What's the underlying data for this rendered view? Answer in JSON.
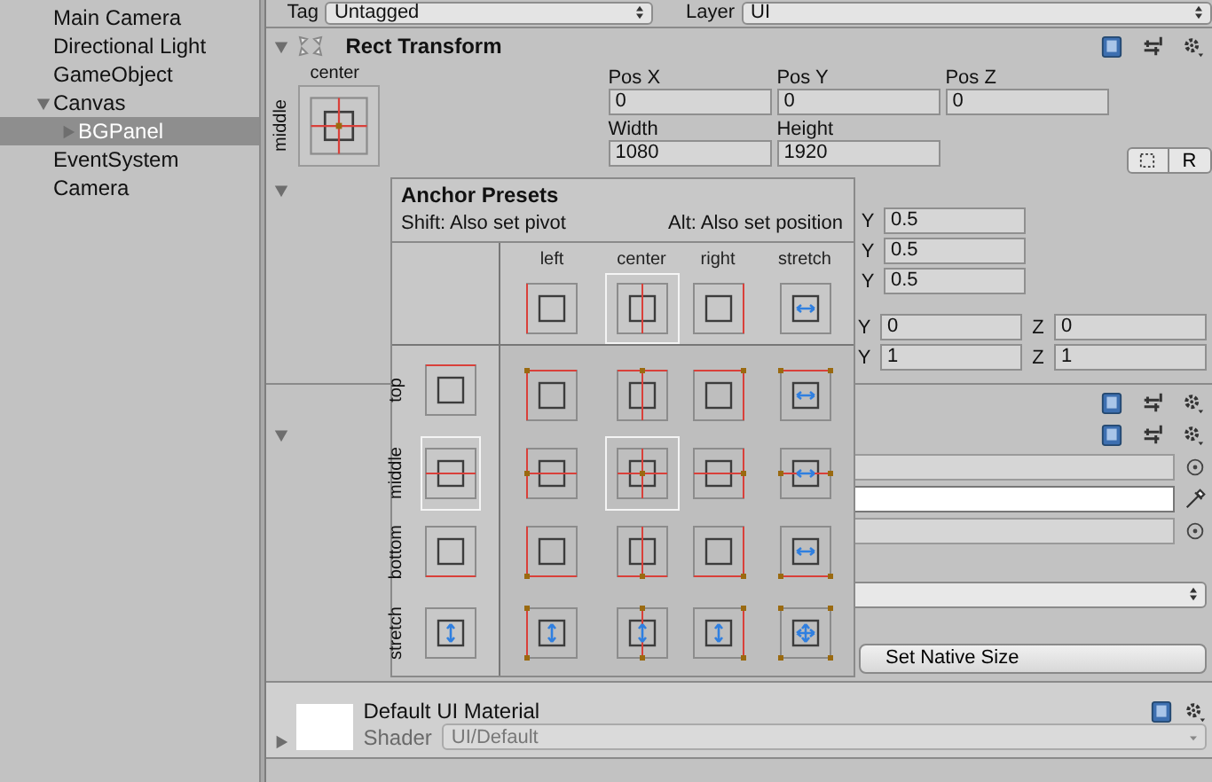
{
  "hierarchy": {
    "items": [
      {
        "label": "Main Camera",
        "selected": false
      },
      {
        "label": "Directional Light",
        "selected": false
      },
      {
        "label": "GameObject",
        "selected": false
      },
      {
        "label": "Canvas",
        "selected": false,
        "expanded": true,
        "children": [
          {
            "label": "BGPanel",
            "selected": true,
            "expanded": false
          }
        ]
      },
      {
        "label": "EventSystem",
        "selected": false
      },
      {
        "label": "Camera",
        "selected": false
      }
    ]
  },
  "inspector": {
    "tag": {
      "label": "Tag",
      "value": "Untagged"
    },
    "layer": {
      "label": "Layer",
      "value": "UI"
    },
    "rect_transform": {
      "title": "Rect Transform",
      "anchor": {
        "h": {
          "label": "center",
          "kind": "center"
        },
        "v": {
          "label": "middle",
          "kind": "middle"
        }
      },
      "fields": [
        {
          "label": "Pos X",
          "value": "0"
        },
        {
          "label": "Pos Y",
          "value": "0"
        },
        {
          "label": "Pos Z",
          "value": "0"
        },
        {
          "label": "Width",
          "value": "1080"
        },
        {
          "label": "Height",
          "value": "1920"
        }
      ],
      "raw_button": "R"
    },
    "vector_rows": [
      {
        "fields": [
          {
            "label": "Y",
            "value": "0.5"
          }
        ]
      },
      {
        "fields": [
          {
            "label": "Y",
            "value": "0.5"
          }
        ]
      },
      {
        "fields": [
          {
            "label": "Y",
            "value": "0.5"
          }
        ]
      },
      {
        "fields": [
          {
            "label": "Y",
            "value": "0"
          },
          {
            "label": "Z",
            "value": "0"
          }
        ]
      },
      {
        "fields": [
          {
            "label": "Y",
            "value": "1"
          },
          {
            "label": "Z",
            "value": "1"
          }
        ]
      }
    ],
    "property_rows": [
      {
        "kind": "object_field"
      },
      {
        "kind": "color_field"
      },
      {
        "kind": "object_field"
      },
      {
        "kind": "blank"
      },
      {
        "kind": "dropdown"
      },
      {
        "kind": "blank"
      },
      {
        "kind": "button",
        "label": "Set Native Size"
      }
    ],
    "material": {
      "name": "Default UI Material",
      "shader_label": "Shader",
      "shader": "UI/Default"
    }
  },
  "anchor_presets": {
    "title": "Anchor Presets",
    "hint_shift": "Shift: Also set pivot",
    "hint_alt": "Alt: Also set position",
    "columns": [
      {
        "label": "left",
        "kind": "left",
        "selected": false
      },
      {
        "label": "center",
        "kind": "center",
        "selected": true
      },
      {
        "label": "right",
        "kind": "right",
        "selected": false
      },
      {
        "label": "stretch",
        "kind": "stretch",
        "selected": false
      }
    ],
    "rows": [
      {
        "label": "top",
        "kind": "top",
        "selected": false
      },
      {
        "label": "middle",
        "kind": "middle",
        "selected": true
      },
      {
        "label": "bottom",
        "kind": "bottom",
        "selected": false
      },
      {
        "label": "stretch",
        "kind": "stretch",
        "selected": false
      }
    ]
  }
}
